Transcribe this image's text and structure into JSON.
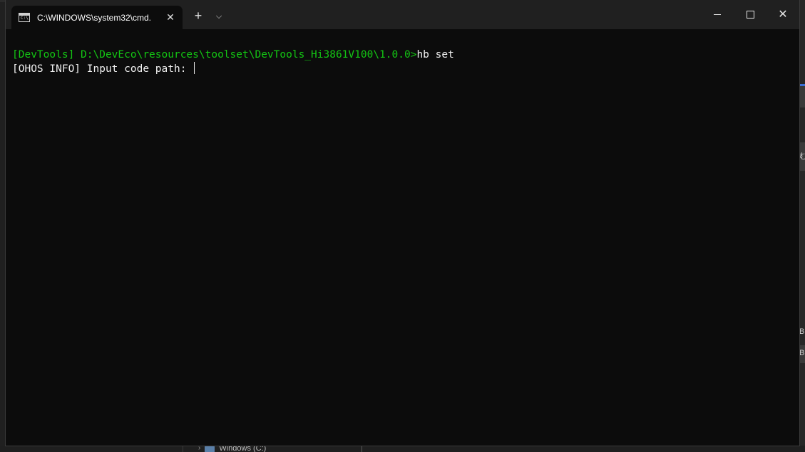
{
  "window": {
    "tab_title": "C:\\WINDOWS\\system32\\cmd.",
    "tab_icon": "cmd-icon",
    "tab_icon_glyph": "C:\\",
    "close_tab_glyph": "✕",
    "new_tab_glyph": "+",
    "dropdown_glyph": "⌵",
    "close_window_glyph": "✕"
  },
  "console": {
    "prompt": "[DevTools] D:\\DevEco\\resources\\toolset\\DevTools_Hi3861V100\\1.0.0>",
    "command": "hb set",
    "output_line": "[OHOS INFO] Input code path: "
  },
  "background": {
    "right_letters": [
      "む",
      "B",
      "B"
    ],
    "bottom_item": "Windows (C:)",
    "bottom_chevron": "›"
  },
  "colors": {
    "console_bg": "#0c0c0c",
    "prompt_green": "#13c613",
    "titlebar_bg": "#202020",
    "text": "#f0f0f0"
  }
}
